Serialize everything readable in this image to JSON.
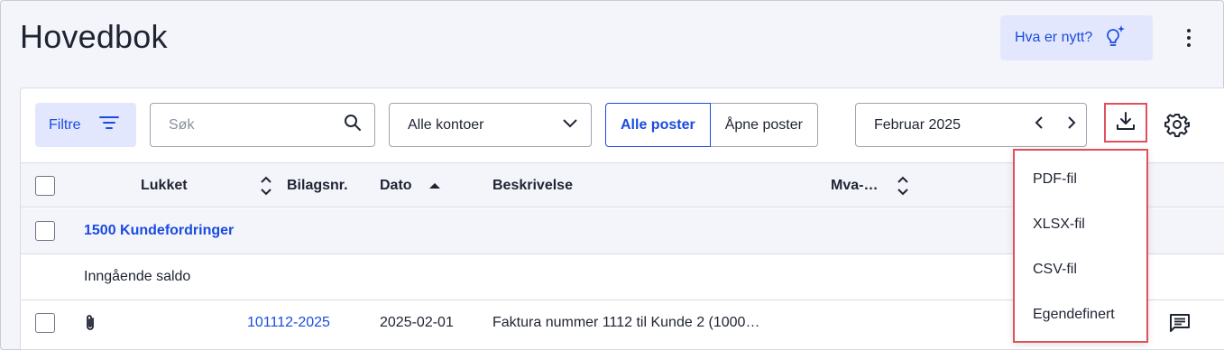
{
  "page": {
    "title": "Hovedbok"
  },
  "header": {
    "whats_new_label": "Hva er nytt?"
  },
  "toolbar": {
    "filter_label": "Filtre",
    "search_placeholder": "Søk",
    "accounts_select_value": "Alle kontoer",
    "segments": [
      "Alle poster",
      "Åpne poster"
    ],
    "active_segment": "Alle poster",
    "period_label": "Februar 2025"
  },
  "table": {
    "columns": {
      "lukket": "Lukket",
      "bilagsnr": "Bilagsnr.",
      "dato": "Dato",
      "beskrivelse": "Beskrivelse",
      "mva": "Mva-…"
    },
    "group_row": {
      "label": "1500 Kundefordringer"
    },
    "opening_row": {
      "label": "Inngående saldo"
    },
    "rows": [
      {
        "bilagsnr": "101112-2025",
        "dato": "2025-02-01",
        "beskrivelse": "Faktura nummer 1112 til Kunde 2 (1000…"
      }
    ]
  },
  "download_menu": {
    "items": [
      "PDF-fil",
      "XLSX-fil",
      "CSV-fil",
      "Egendefinert"
    ]
  },
  "colors": {
    "accent": "#1a4be0",
    "accent_bg": "#e3e7fd",
    "highlight_border": "#e0515d",
    "page_bg": "#f4f5fa"
  }
}
